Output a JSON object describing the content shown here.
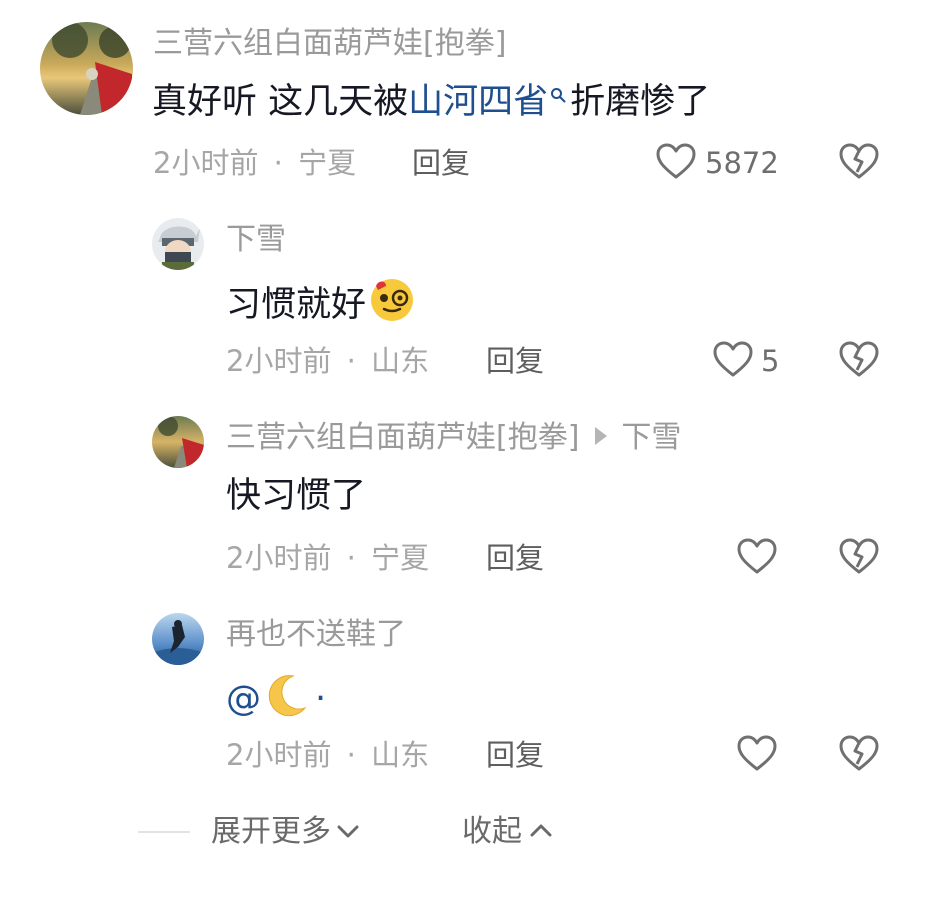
{
  "comments": [
    {
      "author": "三营六组白面葫芦娃[抱拳]",
      "text_before": "真好听 这几天被",
      "link": "山河四省",
      "text_after": "折磨惨了",
      "time": "2小时前",
      "sep": "·",
      "location": "宁夏",
      "reply_label": "回复",
      "likes": "5872"
    },
    {
      "author": "下雪",
      "text": "习惯就好",
      "emoji": "face-with-monocle-emoji",
      "time": "2小时前",
      "sep": "·",
      "location": "山东",
      "reply_label": "回复",
      "likes": "5"
    },
    {
      "author": "三营六组白面葫芦娃[抱拳]",
      "reply_to": "下雪",
      "text": "快习惯了",
      "time": "2小时前",
      "sep": "·",
      "location": "宁夏",
      "reply_label": "回复",
      "likes": ""
    },
    {
      "author": "再也不送鞋了",
      "text": "@",
      "emoji": "crescent-moon-emoji",
      "text_tail": "·",
      "time": "2小时前",
      "sep": "·",
      "location": "山东",
      "reply_label": "回复",
      "likes": ""
    }
  ],
  "footer": {
    "expand_label": "展开更多",
    "collapse_label": "收起"
  },
  "colors": {
    "link": "#1f4f8f",
    "text": "#161823",
    "muted": "#a6a6a6"
  }
}
